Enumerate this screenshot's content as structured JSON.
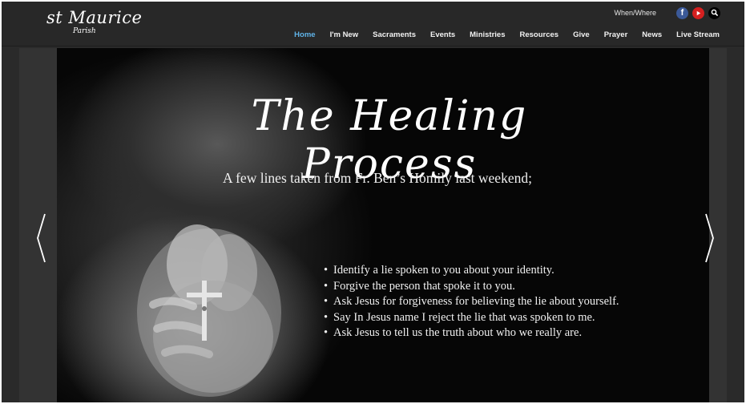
{
  "logo": {
    "main": "st Maurice",
    "sub": "Parish"
  },
  "topbar": {
    "when_where": "When/Where",
    "icons": [
      "facebook-icon",
      "youtube-icon",
      "search-icon"
    ],
    "facebook_glyph": "f"
  },
  "nav": {
    "items": [
      {
        "label": "Home",
        "active": true
      },
      {
        "label": "I'm New"
      },
      {
        "label": "Sacraments"
      },
      {
        "label": "Events"
      },
      {
        "label": "Ministries"
      },
      {
        "label": "Resources"
      },
      {
        "label": "Give"
      },
      {
        "label": "Prayer"
      },
      {
        "label": "News"
      },
      {
        "label": "Live Stream"
      }
    ]
  },
  "slide": {
    "title": "The Healing Process",
    "subtitle": "A few lines taken from Fr. Ben’s Homily last weekend;",
    "bullets": [
      "Identify a lie spoken to you about your identity.",
      "Forgive the person that spoke it to you.",
      "Ask Jesus for forgiveness for believing the lie about yourself.",
      "Say In Jesus name I reject the lie that was spoken to me.",
      "Ask Jesus to tell us the truth about who we really are."
    ]
  },
  "colors": {
    "header_bg": "#282828",
    "accent": "#4aa8e0",
    "facebook": "#3b5998",
    "youtube": "#d62020"
  }
}
